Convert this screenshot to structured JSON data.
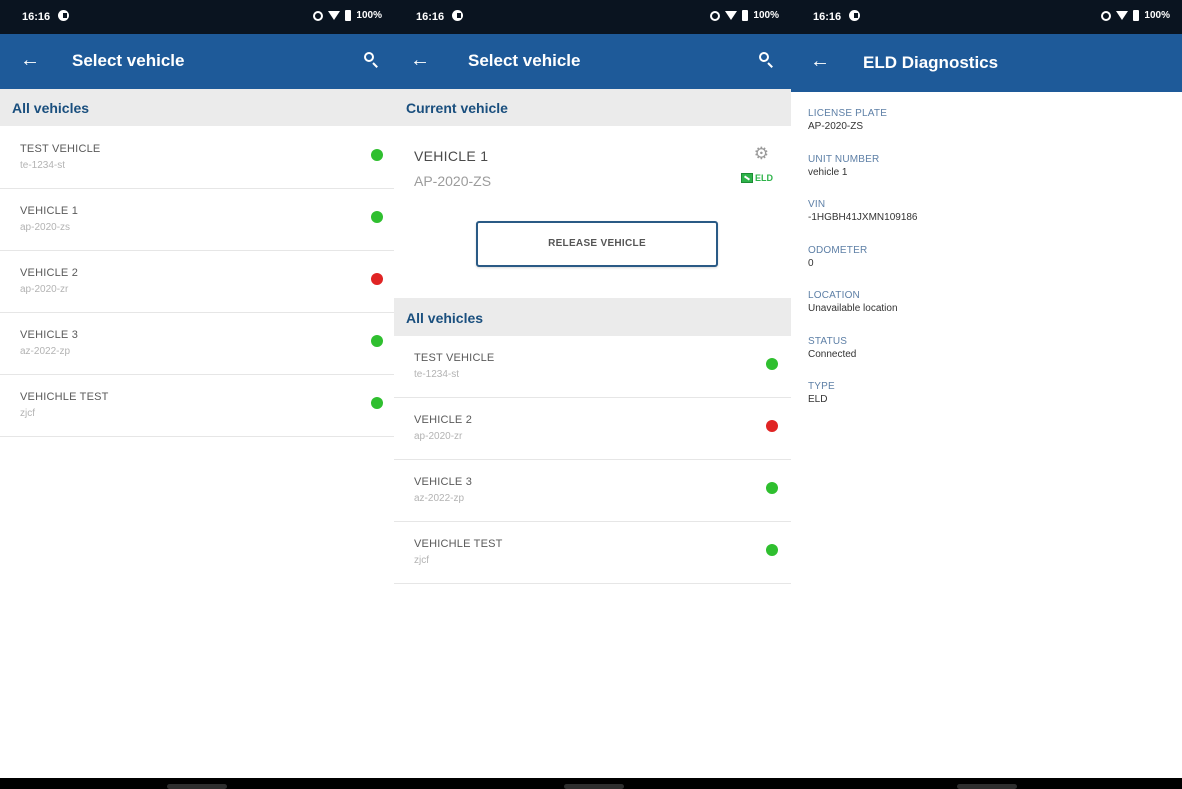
{
  "status_bar": {
    "time": "16:16",
    "battery": "100%"
  },
  "select_vehicle": {
    "title": "Select vehicle",
    "section": "All vehicles",
    "vehicles": [
      {
        "name": "TEST VEHICLE",
        "plate": "te-1234-st",
        "status_color": "#2fbf2f"
      },
      {
        "name": "VEHICLE 1",
        "plate": "ap-2020-zs",
        "status_color": "#2fbf2f"
      },
      {
        "name": "VEHICLE 2",
        "plate": "ap-2020-zr",
        "status_color": "#e02424"
      },
      {
        "name": "VEHICLE 3",
        "plate": "az-2022-zp",
        "status_color": "#2fbf2f"
      },
      {
        "name": "VEHICHLE TEST",
        "plate": "zjcf",
        "status_color": "#2fbf2f"
      }
    ]
  },
  "select_vehicle_current": {
    "title": "Select vehicle",
    "current_section": "Current vehicle",
    "current_vehicle": {
      "name": "VEHICLE 1",
      "plate": "AP-2020-ZS",
      "eld_label": "ELD"
    },
    "release_button": "RELEASE VEHICLE",
    "all_section": "All vehicles",
    "vehicles": [
      {
        "name": "TEST VEHICLE",
        "plate": "te-1234-st",
        "status_color": "#2fbf2f"
      },
      {
        "name": "VEHICLE 2",
        "plate": "ap-2020-zr",
        "status_color": "#e02424"
      },
      {
        "name": "VEHICLE 3",
        "plate": "az-2022-zp",
        "status_color": "#2fbf2f"
      },
      {
        "name": "VEHICHLE TEST",
        "plate": "zjcf",
        "status_color": "#2fbf2f"
      }
    ]
  },
  "eld_diagnostics": {
    "title": "ELD Diagnostics",
    "fields": [
      {
        "label": "LICENSE PLATE",
        "value": "AP-2020-ZS"
      },
      {
        "label": "UNIT NUMBER",
        "value": "vehicle 1"
      },
      {
        "label": "VIN",
        "value": "-1HGBH41JXMN109186"
      },
      {
        "label": "ODOMETER",
        "value": "0"
      },
      {
        "label": "LOCATION",
        "value": "Unavailable location"
      },
      {
        "label": "STATUS",
        "value": "Connected"
      },
      {
        "label": "TYPE",
        "value": "ELD"
      }
    ]
  },
  "colors": {
    "app_bar": "#1e5a99",
    "section_text": "#1a4f7e",
    "online": "#2fbf2f",
    "offline": "#e02424"
  }
}
